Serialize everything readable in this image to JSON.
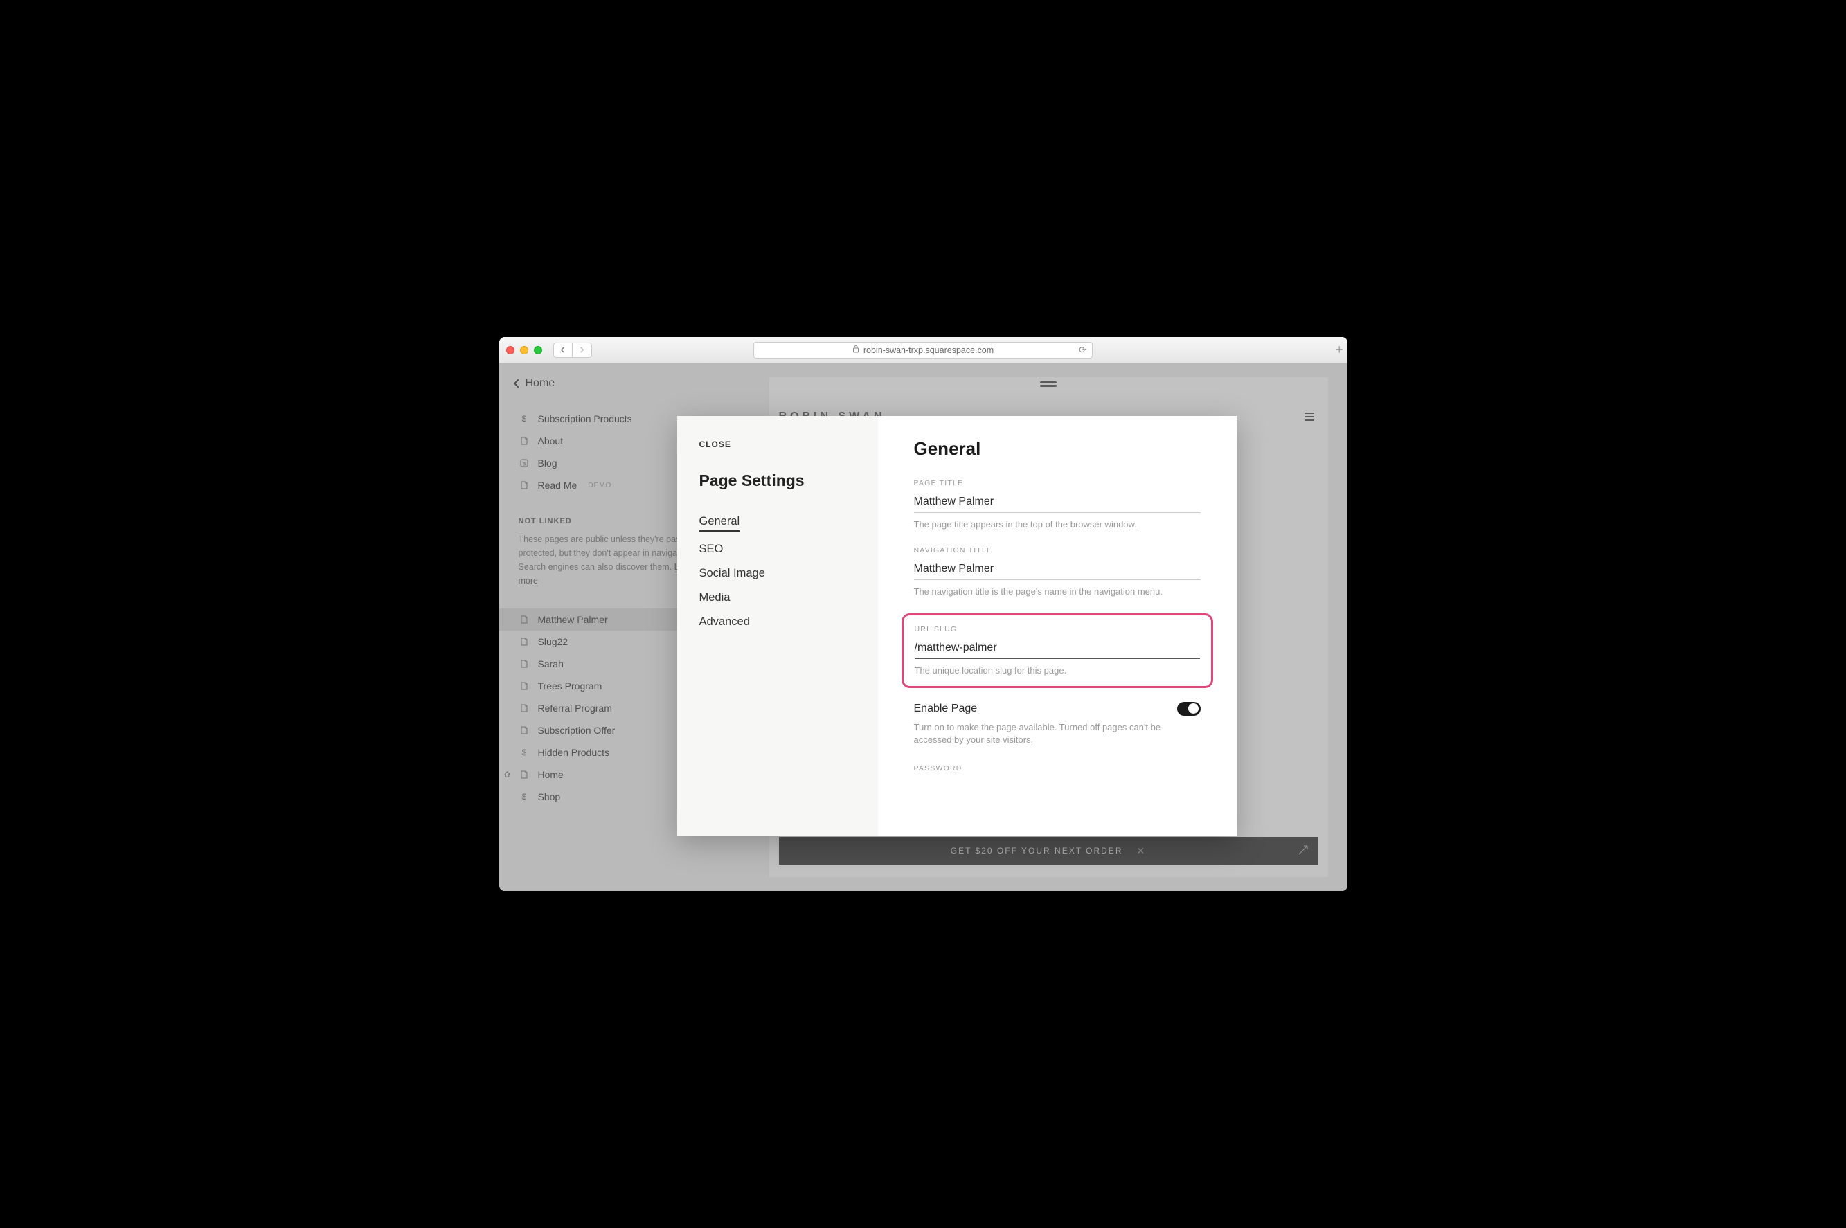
{
  "browser": {
    "url": "robin-swan-trxp.squarespace.com"
  },
  "sidebar": {
    "back_label": "Home",
    "items_top": [
      {
        "icon": "dollar",
        "label": "Subscription Products"
      },
      {
        "icon": "page",
        "label": "About"
      },
      {
        "icon": "blog",
        "label": "Blog"
      },
      {
        "icon": "page",
        "label": "Read Me",
        "demo": "DEMO"
      }
    ],
    "not_linked_label": "NOT LINKED",
    "not_linked_desc": "These pages are public unless they're password-protected, but they don't appear in navigation. Search engines can also discover them.",
    "learn_more": "Learn more",
    "items_bottom": [
      {
        "icon": "page",
        "label": "Matthew Palmer",
        "active": true
      },
      {
        "icon": "page",
        "label": "Slug22"
      },
      {
        "icon": "page",
        "label": "Sarah"
      },
      {
        "icon": "page",
        "label": "Trees Program"
      },
      {
        "icon": "page",
        "label": "Referral Program"
      },
      {
        "icon": "page",
        "label": "Subscription Offer"
      },
      {
        "icon": "dollar",
        "label": "Hidden Products"
      },
      {
        "icon": "page",
        "label": "Home",
        "home": true
      },
      {
        "icon": "dollar",
        "label": "Shop",
        "chevron": true
      }
    ]
  },
  "preview": {
    "site_title": "ROBIN SWAN",
    "promo": "GET $20 OFF YOUR NEXT ORDER"
  },
  "modal": {
    "close": "CLOSE",
    "title": "Page Settings",
    "tabs": [
      "General",
      "SEO",
      "Social Image",
      "Media",
      "Advanced"
    ],
    "heading": "General",
    "page_title": {
      "label": "PAGE TITLE",
      "value": "Matthew Palmer",
      "help": "The page title appears in the top of the browser window."
    },
    "nav_title": {
      "label": "NAVIGATION TITLE",
      "value": "Matthew Palmer",
      "help": "The navigation title is the page's name in the navigation menu."
    },
    "url_slug": {
      "label": "URL SLUG",
      "value": "/matthew-palmer",
      "help": "The unique location slug for this page."
    },
    "enable_page": {
      "label": "Enable Page",
      "help": "Turn on to make the page available. Turned off pages can't be accessed by your site visitors."
    },
    "password": {
      "label": "PASSWORD"
    }
  }
}
